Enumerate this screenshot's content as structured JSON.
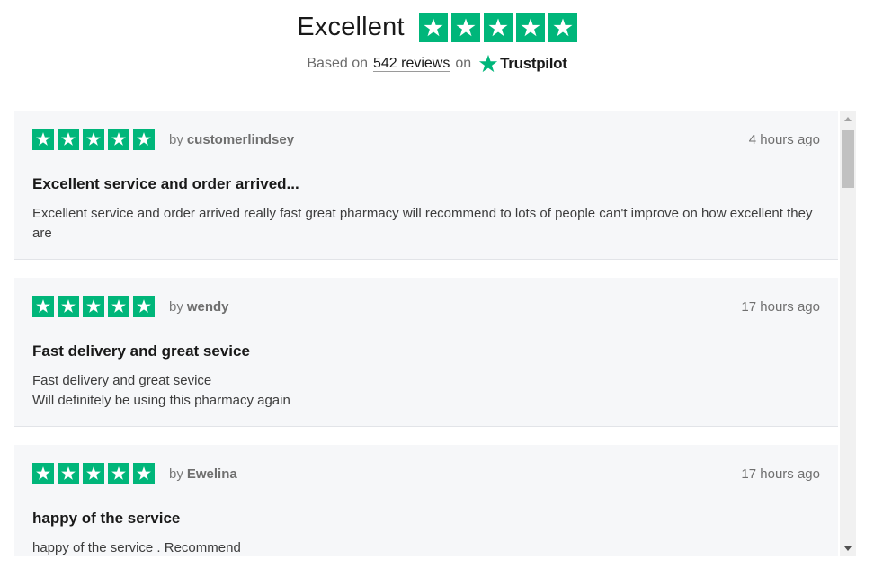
{
  "header": {
    "rating_word": "Excellent",
    "stars": 5,
    "based_on_prefix": "Based on",
    "review_count_link": "542 reviews",
    "on_word": "on",
    "trustpilot_name": "Trustpilot",
    "star_icon": "star-icon",
    "brand_color": "#00b67a"
  },
  "reviews": [
    {
      "stars": 5,
      "by_label": "by",
      "author": "customerlindsey",
      "time_ago": "4 hours ago",
      "title": "Excellent service and order arrived...",
      "body": "Excellent service and order arrived really fast great pharmacy will recommend to lots of people can't improve on how excellent they are"
    },
    {
      "stars": 5,
      "by_label": "by",
      "author": "wendy",
      "time_ago": "17 hours ago",
      "title": "Fast delivery and great sevice",
      "body": "Fast delivery and great sevice\nWill definitely be using this pharmacy again"
    },
    {
      "stars": 5,
      "by_label": "by",
      "author": "Ewelina",
      "time_ago": "17 hours ago",
      "title": "happy of the service",
      "body": "happy of the service . Recommend"
    }
  ]
}
